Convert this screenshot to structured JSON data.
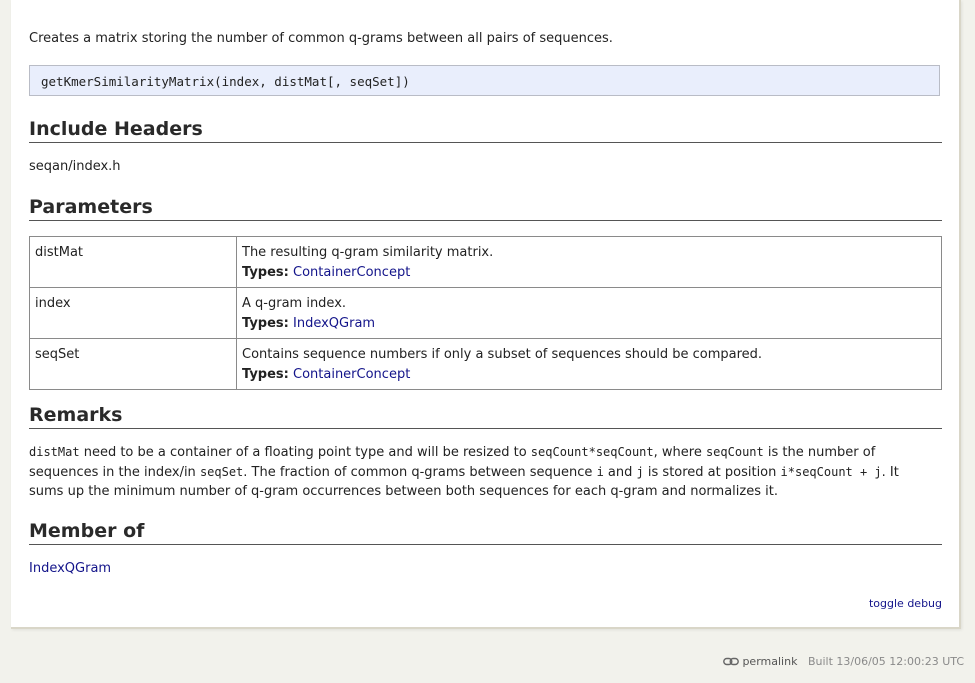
{
  "intro": "Creates a matrix storing the number of common q-grams between all pairs of sequences.",
  "signature": "getKmerSimilarityMatrix(index, distMat[, seqSet])",
  "headers": {
    "include": "Include Headers",
    "parameters": "Parameters",
    "remarks": "Remarks",
    "member_of": "Member of"
  },
  "include_file": "seqan/index.h",
  "types_label": "Types:",
  "params": [
    {
      "name": "distMat",
      "desc": "The resulting q-gram similarity matrix.",
      "type": "ContainerConcept"
    },
    {
      "name": "index",
      "desc": "A q-gram index.",
      "type": "IndexQGram"
    },
    {
      "name": "seqSet",
      "desc": "Contains sequence numbers if only a subset of sequences should be compared.",
      "type": "ContainerConcept"
    }
  ],
  "remarks": {
    "c1": "distMat",
    "t1": " need to be a container of a floating point type and will be resized to ",
    "c2": "seqCount*seqCount",
    "t2": ", where ",
    "c3": "seqCount",
    "t3": " is the number of sequences in the index/in ",
    "c4": "seqSet",
    "t4": ". The fraction of common q-grams between sequence ",
    "c5": "i",
    "t5": " and ",
    "c6": "j",
    "t6": " is stored at position ",
    "c7": "i*seqCount + j",
    "t7": ". It sums up the minimum number of q-gram occurrences between both sequences for each q-gram and normalizes it."
  },
  "member_of_link": "IndexQGram",
  "toggle_debug": "toggle debug",
  "footer": {
    "permalink": "permalink",
    "built": "Built 13/06/05 12:00:23 UTC"
  },
  "colors": {
    "link": "#13148a",
    "signature_bg": "#e9eefc",
    "page_bg": "#f2f2ec"
  }
}
